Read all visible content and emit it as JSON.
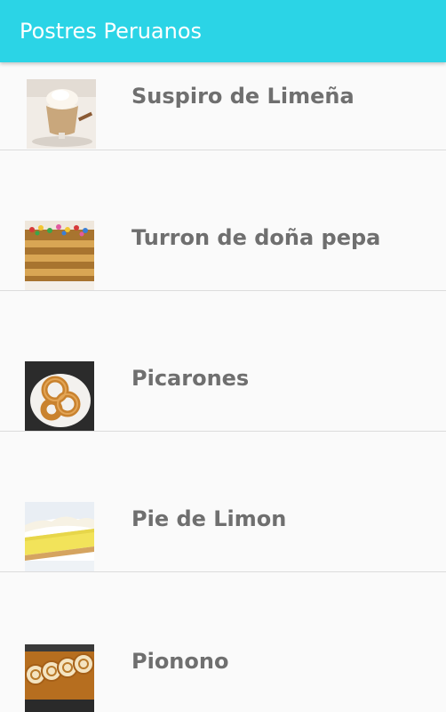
{
  "app": {
    "title": "Postres Peruanos",
    "accent_color": "#2bd4e6"
  },
  "list": {
    "items": [
      {
        "label": "Suspiro de Limeña",
        "image": "suspiro-dessert-photo"
      },
      {
        "label": "Turron de doña pepa",
        "image": "turron-dessert-photo"
      },
      {
        "label": "Picarones",
        "image": "picarones-dessert-photo"
      },
      {
        "label": "Pie de Limon",
        "image": "lemon-pie-dessert-photo"
      },
      {
        "label": "Pionono",
        "image": "pionono-dessert-photo"
      }
    ]
  }
}
